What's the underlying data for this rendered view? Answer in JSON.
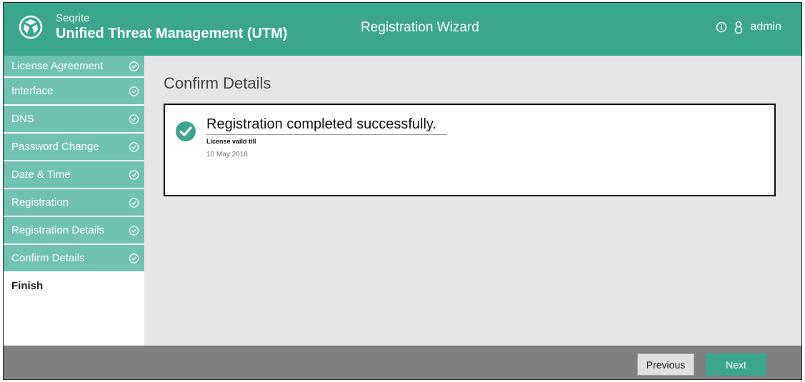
{
  "header": {
    "brand_small": "Seqrite",
    "brand_big": "Unified Threat Management (UTM)",
    "wizard_title": "Registration Wizard",
    "user": "admin",
    "accent_color": "#3aa68e",
    "info_icon": "info-icon",
    "user_icon": "user-icon"
  },
  "sidebar": {
    "items": [
      {
        "label": "License Agreement",
        "status": "completed"
      },
      {
        "label": "Interface",
        "status": "completed"
      },
      {
        "label": "DNS",
        "status": "completed"
      },
      {
        "label": "Password Change",
        "status": "completed"
      },
      {
        "label": "Date & Time",
        "status": "completed"
      },
      {
        "label": "Registration",
        "status": "completed"
      },
      {
        "label": "Registration Details",
        "status": "completed"
      },
      {
        "label": "Confirm Details",
        "status": "completed"
      },
      {
        "label": "Finish",
        "status": "current"
      }
    ]
  },
  "main": {
    "title": "Confirm Details",
    "success_message": "Registration completed successfully.",
    "license_label": "License vaild till",
    "license_date": "10 May 2018"
  },
  "footer": {
    "previous_label": "Previous",
    "next_label": "Next"
  }
}
